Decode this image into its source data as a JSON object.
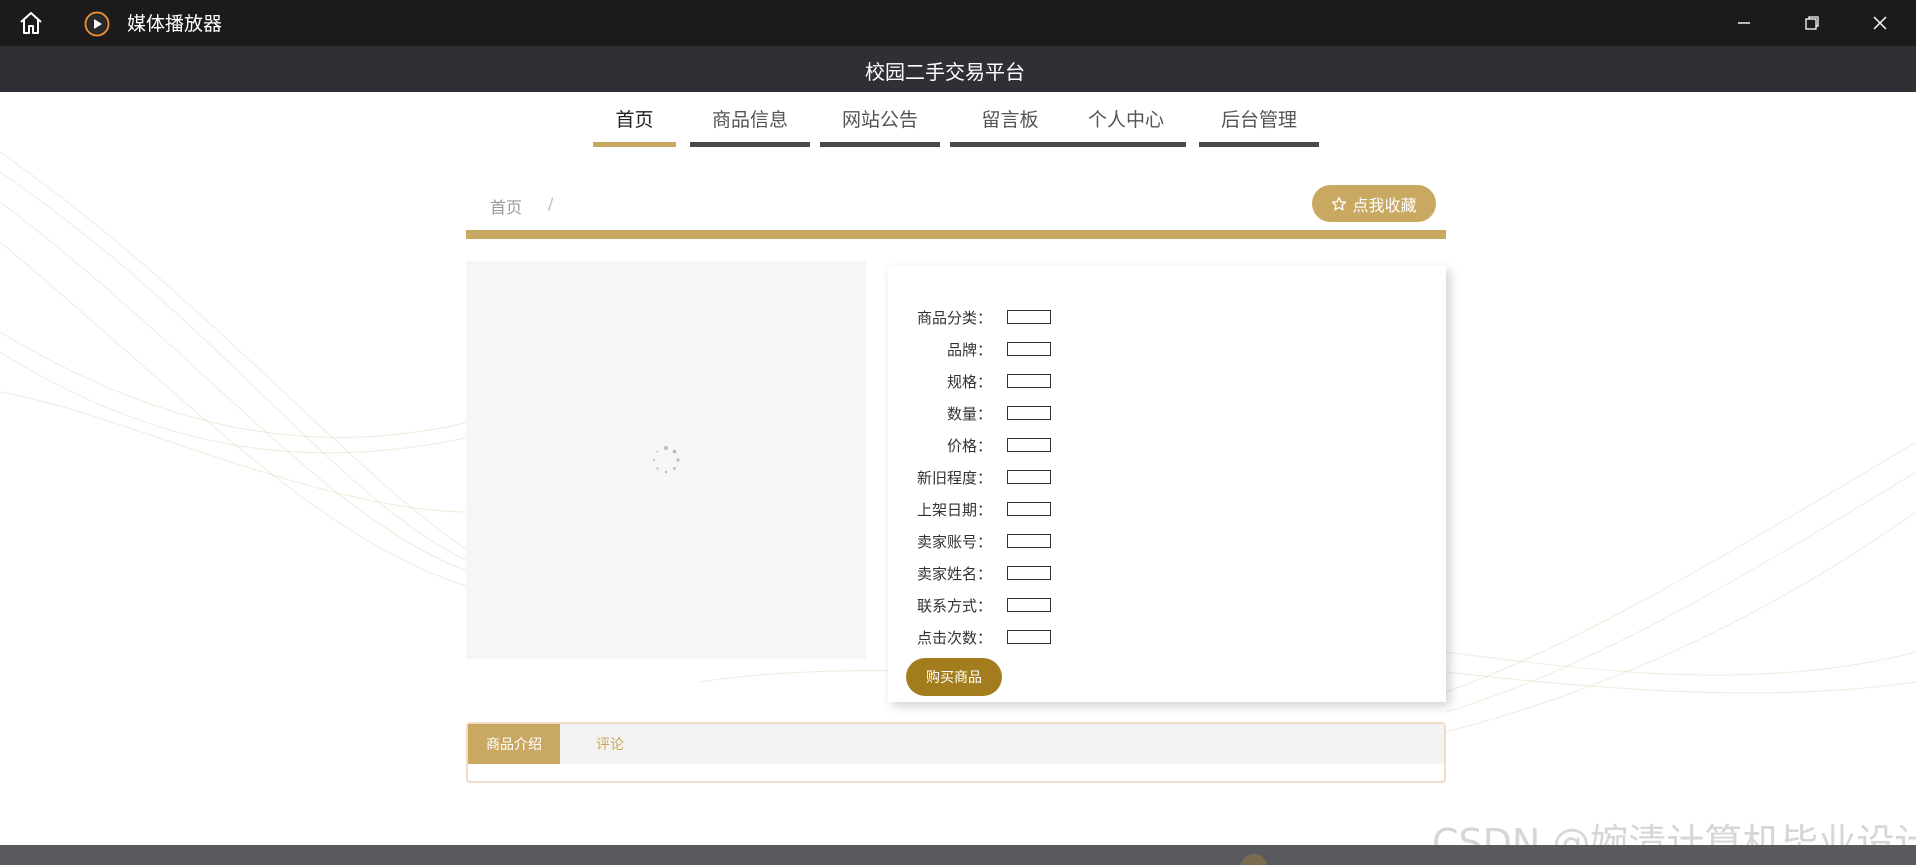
{
  "app": {
    "title": "媒体播放器"
  },
  "site": {
    "title": "校园二手交易平台"
  },
  "nav": {
    "items": [
      "首页",
      "商品信息",
      "网站公告",
      "留言板",
      "个人中心",
      "后台管理"
    ],
    "active": "首页"
  },
  "breadcrumb": {
    "home": "首页",
    "separator": "/"
  },
  "favorite": {
    "icon": "star-outline-icon",
    "label": "点我收藏"
  },
  "details": {
    "fields": [
      {
        "label": "商品分类：",
        "value": ""
      },
      {
        "label": "品牌：",
        "value": ""
      },
      {
        "label": "规格：",
        "value": ""
      },
      {
        "label": "数量：",
        "value": ""
      },
      {
        "label": "价格：",
        "value": ""
      },
      {
        "label": "新旧程度：",
        "value": ""
      },
      {
        "label": "上架日期：",
        "value": ""
      },
      {
        "label": "卖家账号：",
        "value": ""
      },
      {
        "label": "卖家姓名：",
        "value": ""
      },
      {
        "label": "联系方式：",
        "value": ""
      },
      {
        "label": "点击次数：",
        "value": ""
      }
    ],
    "buy_label": "购买商品"
  },
  "tabs": {
    "items": [
      "商品介绍",
      "评论"
    ],
    "active": "商品介绍"
  },
  "watermark": "CSDN @婉清计算机毕业设计",
  "colors": {
    "accent": "#c9a862",
    "buy_button": "#a37c1e",
    "titlebar": "#1b1b1b",
    "site_header": "#2e3035"
  }
}
